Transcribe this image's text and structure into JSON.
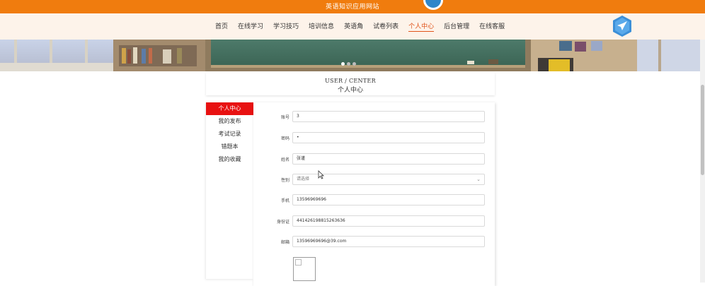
{
  "site_title": "英语知识应用网站",
  "nav": {
    "items": [
      "首页",
      "在线学习",
      "学习技巧",
      "培训信息",
      "英语角",
      "试卷列表",
      "个人中心",
      "后台管理",
      "在线客服"
    ],
    "active_index": 6
  },
  "center_header": {
    "en": "USER / CENTER",
    "zh": "个人中心"
  },
  "sidebar": {
    "items": [
      "个人中心",
      "我的发布",
      "考试记录",
      "错题本",
      "我的收藏"
    ],
    "active_index": 0
  },
  "form": {
    "account": {
      "label": "账号",
      "value": "3"
    },
    "password": {
      "label": "密码",
      "value": "•"
    },
    "name": {
      "label": "姓名",
      "value": "张谨"
    },
    "gender": {
      "label": "性别",
      "placeholder": "请选择"
    },
    "phone": {
      "label": "手机",
      "value": "13596969696"
    },
    "id_card": {
      "label": "身份证",
      "value": "441426198815263636"
    },
    "email": {
      "label": "邮箱",
      "value": "13596969696@39.com"
    }
  },
  "colors": {
    "topbar": "#f07c0e",
    "nav_background": "#fdf3ea",
    "active_nav": "#e0531a",
    "sidebar_active": "#e81111"
  },
  "icons": {
    "nav_logo": "bird-shield-logo",
    "select_chevron": "chevron-down-icon"
  }
}
